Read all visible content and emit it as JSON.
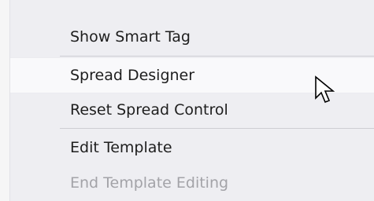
{
  "context_menu": {
    "items": [
      {
        "label": "Show Smart Tag",
        "state": "normal"
      },
      {
        "label": "Spread Designer",
        "state": "hovered"
      },
      {
        "label": "Reset Spread Control",
        "state": "normal"
      },
      {
        "label": "Edit Template",
        "state": "normal"
      },
      {
        "label": "End Template Editing",
        "state": "disabled"
      }
    ],
    "colors": {
      "background": "#eeeef2",
      "hover_background": "#f9f9fb",
      "text": "#1e1e1e",
      "disabled_text": "#a3a3a8",
      "separator": "#cdcdd3"
    }
  },
  "cursor": {
    "icon": "arrow-pointer-icon"
  }
}
